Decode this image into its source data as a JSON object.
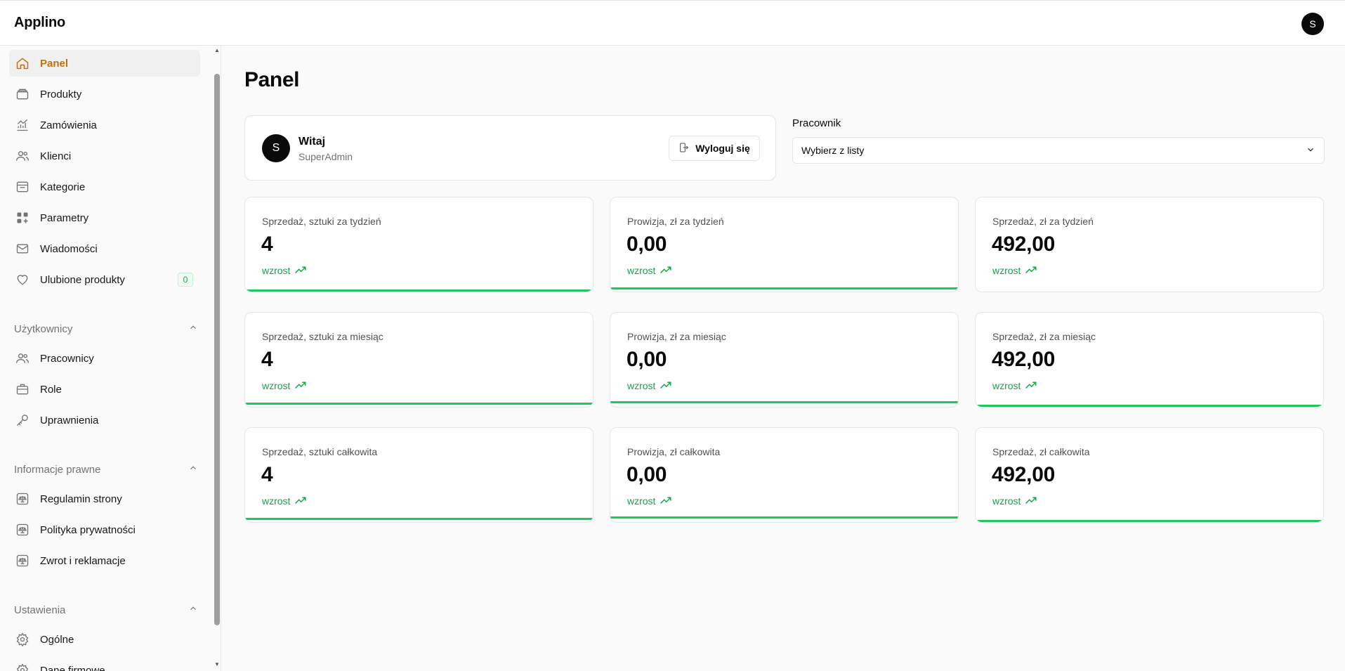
{
  "app": {
    "brand": "Applino",
    "avatar_initial": "S"
  },
  "sidebar": {
    "items": [
      {
        "label": "Panel",
        "icon": "home-icon",
        "active": true
      },
      {
        "label": "Produkty",
        "icon": "layers-icon"
      },
      {
        "label": "Zamówienia",
        "icon": "chart-line-icon"
      },
      {
        "label": "Klienci",
        "icon": "users-icon"
      },
      {
        "label": "Kategorie",
        "icon": "folder-icon"
      },
      {
        "label": "Parametry",
        "icon": "grid-icon"
      },
      {
        "label": "Wiadomości",
        "icon": "mail-icon"
      },
      {
        "label": "Ulubione produkty",
        "icon": "heart-icon",
        "badge": "0"
      }
    ],
    "sections": [
      {
        "title": "Użytkownicy",
        "items": [
          {
            "label": "Pracownicy",
            "icon": "users-icon"
          },
          {
            "label": "Role",
            "icon": "briefcase-icon"
          },
          {
            "label": "Uprawnienia",
            "icon": "key-icon"
          }
        ]
      },
      {
        "title": "Informacje prawne",
        "items": [
          {
            "label": "Regulamin strony",
            "icon": "scale-icon"
          },
          {
            "label": "Polityka prywatności",
            "icon": "scale-icon"
          },
          {
            "label": "Zwrot i reklamacje",
            "icon": "scale-icon"
          }
        ]
      },
      {
        "title": "Ustawienia",
        "items": [
          {
            "label": "Ogólne",
            "icon": "gear-icon"
          },
          {
            "label": "Dane firmowe",
            "icon": "gear-icon"
          }
        ]
      }
    ]
  },
  "main": {
    "title": "Panel",
    "welcome": {
      "avatar_initial": "S",
      "greeting": "Witaj",
      "role": "SuperAdmin",
      "logout_label": "Wyloguj się"
    },
    "employee": {
      "label": "Pracownik",
      "value": "Wybierz z listy"
    },
    "cards": [
      {
        "label": "Sprzedaż, sztuki za tydzień",
        "value": "4",
        "trend": "wzrost"
      },
      {
        "label": "Prowizja, zł za tydzień",
        "value": "0,00",
        "trend": "wzrost"
      },
      {
        "label": "Sprzedaż, zł za tydzień",
        "value": "492,00",
        "trend": "wzrost"
      },
      {
        "label": "Sprzedaż, sztuki za miesiąc",
        "value": "4",
        "trend": "wzrost"
      },
      {
        "label": "Prowizja, zł za miesiąc",
        "value": "0,00",
        "trend": "wzrost"
      },
      {
        "label": "Sprzedaż, zł za miesiąc",
        "value": "492,00",
        "trend": "wzrost"
      },
      {
        "label": "Sprzedaż, sztuki całkowita",
        "value": "4",
        "trend": "wzrost"
      },
      {
        "label": "Prowizja, zł całkowita",
        "value": "0,00",
        "trend": "wzrost"
      },
      {
        "label": "Sprzedaż, zł całkowita",
        "value": "492,00",
        "trend": "wzrost"
      }
    ]
  },
  "colors": {
    "accent": "#c2710c",
    "success": "#16a34a",
    "bar": "#22c55e"
  }
}
